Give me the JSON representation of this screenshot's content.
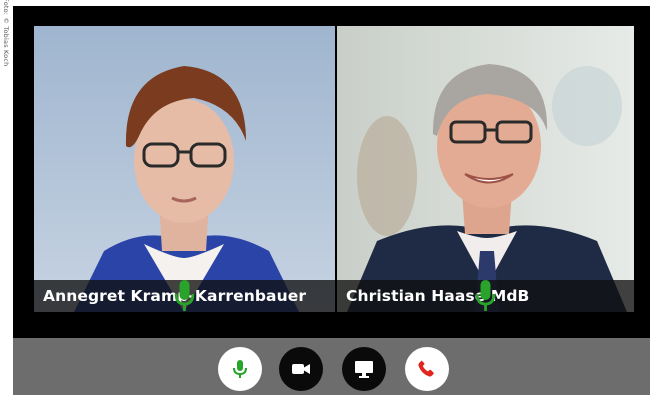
{
  "photo_credit": "Foto: © Tobias Koch",
  "participants": [
    {
      "name": "Annegret Kramp-Karrenbauer",
      "mic": "mic-on"
    },
    {
      "name": "Christian Haase MdB",
      "mic": "mic-on"
    }
  ],
  "controls": [
    {
      "id": "microphone",
      "icon": "microphone-icon",
      "state": "on",
      "color": "#29a329"
    },
    {
      "id": "camera",
      "icon": "video-camera-icon",
      "color": "#ffffff"
    },
    {
      "id": "screen-share",
      "icon": "monitor-icon",
      "color": "#ffffff"
    },
    {
      "id": "hang-up",
      "icon": "phone-hangup-icon",
      "color": "#e0261e"
    }
  ],
  "colors": {
    "mic_active": "#29a329",
    "hangup": "#e0261e",
    "toolbar_bg": "#6d6d6d"
  }
}
